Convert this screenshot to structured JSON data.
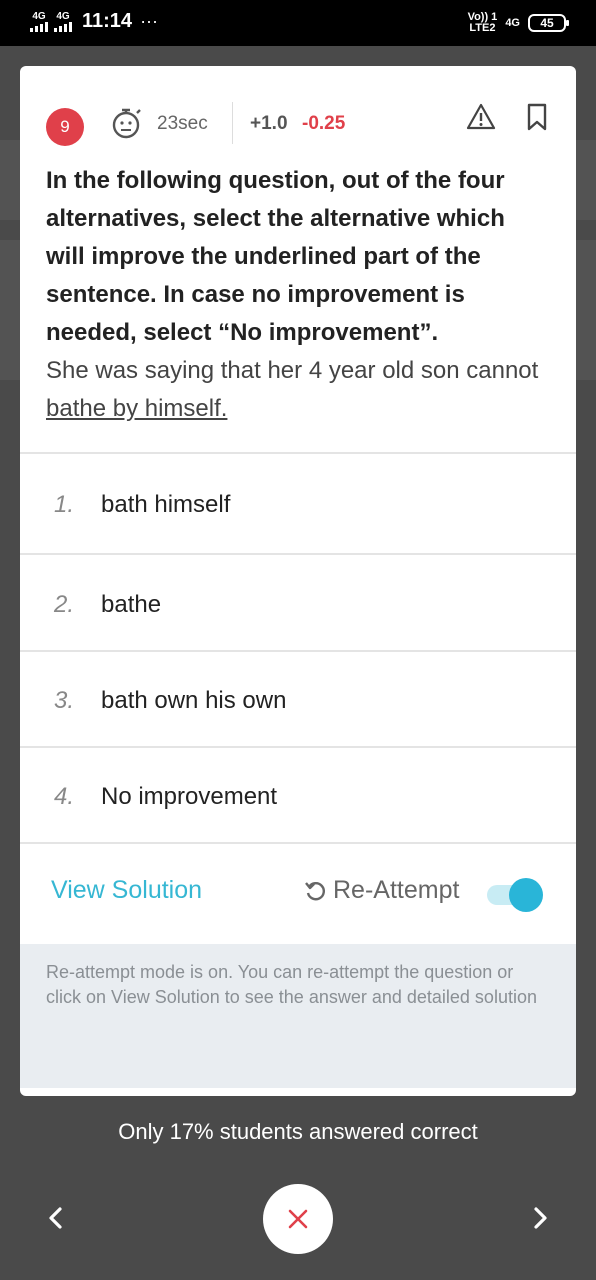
{
  "status_bar": {
    "network_1": "4G",
    "network_2": "4G",
    "time": "11:14",
    "dots": "···",
    "volte": "Vo)) 1",
    "lte": "LTE2",
    "net_right": "4G",
    "battery": "45"
  },
  "question": {
    "number": "9",
    "time_spent": "23sec",
    "positive_marks": "+1.0",
    "negative_marks": "-0.25",
    "instruction": "In the following question, out of the four alternatives, select the alternative which will improve the underlined part of the sentence. In case no improvement is needed, select “No improvement”.",
    "sentence_prefix": "She was saying that her 4 year old son cannot ",
    "sentence_underlined": "bathe by himself."
  },
  "options": [
    {
      "num": "1.",
      "text": "bath himself"
    },
    {
      "num": "2.",
      "text": "bathe"
    },
    {
      "num": "3.",
      "text": "bath own his own"
    },
    {
      "num": "4.",
      "text": "No improvement"
    }
  ],
  "actions": {
    "view_solution": "View Solution",
    "reattempt": "Re-Attempt",
    "reattempt_on": true
  },
  "note": "Re-attempt mode is on. You can re-attempt the question or click on View Solution to see the answer and detailed solution",
  "stats": "Only 17% students answered correct",
  "colors": {
    "accent": "#29b5d8",
    "wrong": "#e0404a",
    "overlay": "#4a4a4a"
  }
}
